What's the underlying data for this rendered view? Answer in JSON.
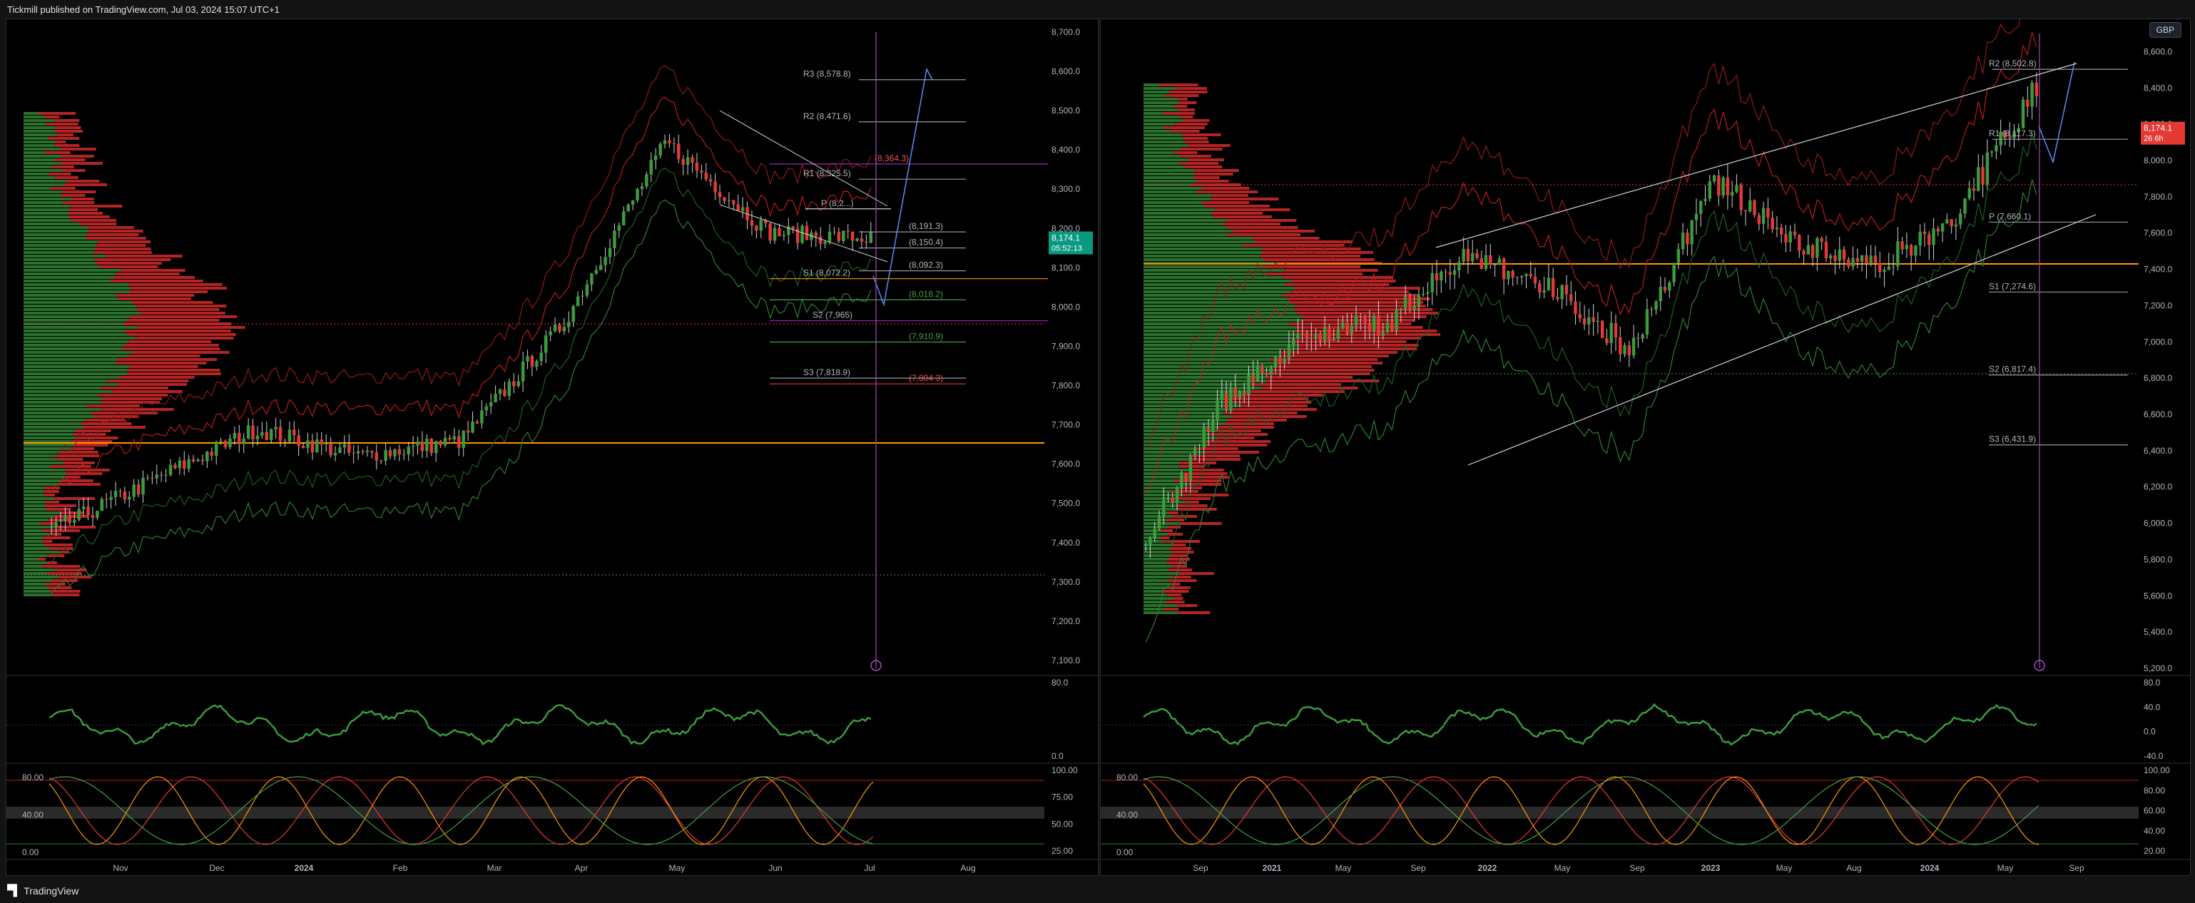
{
  "header": {
    "publisher": "Tickmill published on TradingView.com, Jul 03, 2024 15:07 UTC+1"
  },
  "footer": {
    "brand": "TradingView"
  },
  "colors": {
    "bull": "#3a9c3a",
    "bear": "#e53935",
    "orange": "#ff9800",
    "purple": "#9c27b0",
    "blue": "#2962ff",
    "price_badge": "#089981"
  },
  "left": {
    "price_axis": [
      "8,700.0",
      "8,600.0",
      "8,500.0",
      "8,400.0",
      "8,300.0",
      "8,200.0",
      "8,100.0",
      "8,000.0",
      "7,900.0",
      "7,800.0",
      "7,700.0",
      "7,600.0",
      "7,500.0",
      "7,400.0",
      "7,300.0",
      "7,200.0",
      "7,100.0"
    ],
    "time_axis": [
      "Nov",
      "Dec",
      "2024",
      "Feb",
      "Mar",
      "Apr",
      "May",
      "Jun",
      "Jul",
      "Aug"
    ],
    "last_price": "8,174.1",
    "countdown": "05:52:13",
    "levels": [
      {
        "label": "R3 (8,578.8)"
      },
      {
        "label": "R2 (8,471.6)"
      },
      {
        "label": "(8,364.3)"
      },
      {
        "label": "R1 (8,325.5)"
      },
      {
        "label": "(8,191.3)"
      },
      {
        "label": "(8,150.4)"
      },
      {
        "label": "(8,092.3)"
      },
      {
        "label": "S1 (8,072.2)"
      },
      {
        "label": "(8,018.2)"
      },
      {
        "label": "S2 (7,965)"
      },
      {
        "label": "(7,910.9)"
      },
      {
        "label": "S3 (7,818.9)"
      },
      {
        "label": "(7,804.3)"
      },
      {
        "label": "P (8,2...)"
      }
    ],
    "osc1_axis": [
      "80.0",
      "0.0"
    ],
    "osc2_axis_left": [
      "80.00",
      "40.00",
      "0.00"
    ],
    "osc2_axis_right": [
      "100.00",
      "75.00",
      "50.00",
      "25.00"
    ]
  },
  "right": {
    "currency": "GBP",
    "price_axis": [
      "8,600.0",
      "8,400.0",
      "8,200.0",
      "8,000.0",
      "7,800.0",
      "7,600.0",
      "7,400.0",
      "7,200.0",
      "7,000.0",
      "6,800.0",
      "6,600.0",
      "6,400.0",
      "6,200.0",
      "6,000.0",
      "5,800.0",
      "5,600.0",
      "5,400.0",
      "5,200.0"
    ],
    "time_axis": [
      "Sep",
      "2021",
      "May",
      "Sep",
      "2022",
      "May",
      "Sep",
      "2023",
      "May",
      "Aug",
      "2024",
      "May",
      "Sep"
    ],
    "last_price": "8,174.1",
    "countdown": "26 6h",
    "levels": [
      {
        "label": "R2 (8,502.8)"
      },
      {
        "label": "R1 (8,117.3)"
      },
      {
        "label": "P (7,660.1)"
      },
      {
        "label": "S1 (7,274.6)"
      },
      {
        "label": "S2 (6,817.4)"
      },
      {
        "label": "S3 (6,431.9)"
      }
    ],
    "osc1_axis": [
      "80.0",
      "40.0",
      "0.0",
      "-40.0"
    ],
    "osc2_axis_left": [
      "80.00",
      "40.00",
      "0.00"
    ],
    "osc2_axis_right": [
      "100.00",
      "80.00",
      "60.00",
      "40.00",
      "20.00"
    ]
  },
  "chart_data": [
    {
      "type": "candlestick",
      "title": "",
      "x": [
        "Nov",
        "Dec",
        "2024",
        "Feb",
        "Mar",
        "Apr",
        "May",
        "Jun",
        "Jul"
      ],
      "ylim": [
        7080,
        8700
      ],
      "series": [
        {
          "values": [
            7430,
            7560,
            7690,
            7620,
            7660,
            7960,
            8420,
            8190,
            8174
          ]
        }
      ],
      "pivots": {
        "R3": 8578.8,
        "R2": 8471.6,
        "R1": 8325.5,
        "S1": 8072.2,
        "S2": 7965,
        "S3": 7818.9
      },
      "last": 8174.1
    },
    {
      "type": "candlestick",
      "title": "",
      "x": [
        "Sep",
        "2021",
        "May",
        "Sep",
        "2022",
        "May",
        "Sep",
        "2023",
        "May",
        "Aug",
        "2024",
        "May"
      ],
      "ylim": [
        5200,
        8700
      ],
      "series": [
        {
          "values": [
            5900,
            6700,
            7050,
            7100,
            7500,
            7300,
            6950,
            7900,
            7550,
            7400,
            7700,
            8400
          ]
        }
      ],
      "pivots": {
        "R2": 8502.8,
        "R1": 8117.3,
        "P": 7660.1,
        "S1": 7274.6,
        "S2": 6817.4,
        "S3": 6431.9
      },
      "last": 8174.1
    }
  ]
}
